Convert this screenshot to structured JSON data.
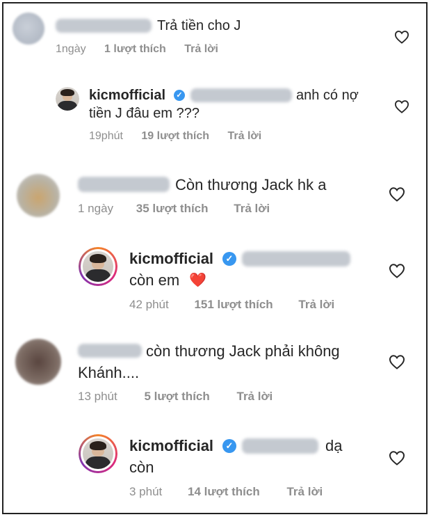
{
  "comments": [
    {
      "text": "Trả tiền cho J",
      "time": "1ngày",
      "likes": "1 lượt thích",
      "reply": "Trả lời"
    },
    {
      "username": "kicmofficial",
      "text_line1": "anh có nợ",
      "text_line2": "tiền J đâu em ???",
      "time": "19phút",
      "likes": "19 lượt thích",
      "reply": "Trả lời"
    },
    {
      "text": "Còn thương Jack hk a",
      "time": "1 ngày",
      "likes": "35 lượt thích",
      "reply": "Trả lời"
    },
    {
      "username": "kicmofficial",
      "text_line2": "còn em",
      "emoji": "❤️",
      "time": "42 phút",
      "likes": "151 lượt thích",
      "reply": "Trả lời"
    },
    {
      "text_line1": "còn thương Jack phải không",
      "text_line2": "Khánh....",
      "time": "13 phút",
      "likes": "5 lượt thích",
      "reply": "Trả lời"
    },
    {
      "username": "kicmofficial",
      "text_line1": "dạ",
      "text_line2": "còn",
      "time": "3 phút",
      "likes": "14 lượt thích",
      "reply": "Trả lời"
    }
  ],
  "icons": {
    "verified": "verified-badge-icon",
    "heart": "heart-outline-icon"
  },
  "colors": {
    "verified": "#3897f0",
    "meta": "#8e8e8e",
    "emoji_heart": "#e0245e"
  }
}
